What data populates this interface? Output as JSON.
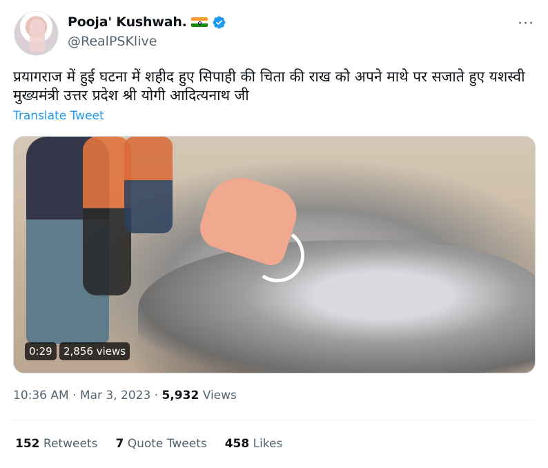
{
  "user": {
    "display_name": "Pooja' Kushwah.",
    "handle": "@RealPSKlive",
    "flag_icon": "india-flag-icon",
    "verified_icon": "verified-badge-icon",
    "verified_color": "#1d9bf0"
  },
  "more_label": "···",
  "tweet": {
    "text": "प्रयागराज में हुई घटना में शहीद हुए सिपाही की चिता की राख को अपने माथे पर सजाते हुए यशस्वी मुख्यमंत्री उत्तर प्रदेश श्री योगी आदित्यनाथ जी",
    "translate_label": "Translate Tweet"
  },
  "video": {
    "duration": "0:29",
    "views": "2,856 views"
  },
  "meta": {
    "time": "10:36 AM",
    "separator": "·",
    "date": "Mar 3, 2023",
    "views_count": "5,932",
    "views_label": "Views"
  },
  "stats": {
    "retweets_count": "152",
    "retweets_label": "Retweets",
    "quotes_count": "7",
    "quotes_label": "Quote Tweets",
    "likes_count": "458",
    "likes_label": "Likes"
  },
  "colors": {
    "link": "#1d9bf0",
    "secondary_text": "#536471",
    "primary_text": "#0f1419"
  }
}
